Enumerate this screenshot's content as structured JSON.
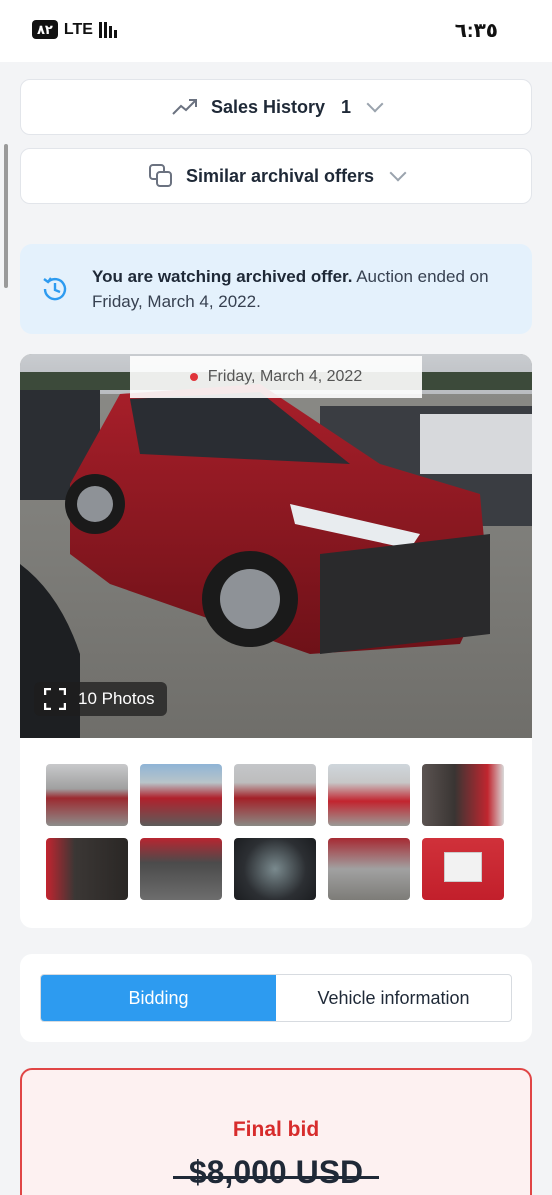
{
  "status_bar": {
    "battery": "۸۲",
    "network": "LTE",
    "time": "٦:٣٥"
  },
  "sales_history": {
    "label": "Sales History",
    "count": "1",
    "icon": "trending-up-icon"
  },
  "similar_offers": {
    "label": "Similar archival offers",
    "icon": "copy-icon"
  },
  "notice": {
    "bold": "You are watching archived offer.",
    "text": " Auction ended on Friday, March 4, 2022.",
    "icon": "history-icon"
  },
  "gallery": {
    "date": "Friday, March 4, 2022",
    "photos_label": "10 Photos"
  },
  "tabs": {
    "bidding": "Bidding",
    "vehicle_info": "Vehicle information",
    "active": "bidding"
  },
  "bid": {
    "label": "Final bid",
    "amount": "$8,000 USD"
  },
  "colors": {
    "accent": "#2d9bf0",
    "alert": "#e04545",
    "notice_bg": "#e4f1fc"
  }
}
